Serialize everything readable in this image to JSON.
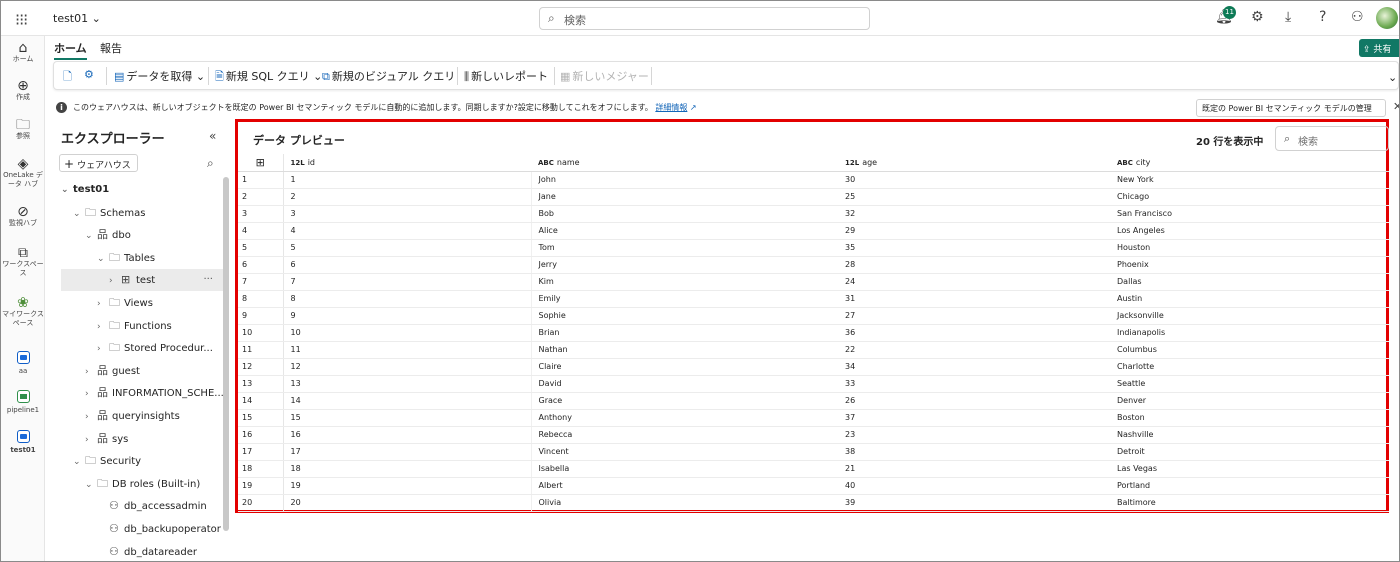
{
  "topbar": {
    "workspace": "test01",
    "search_placeholder": "検索",
    "notification_count": "11"
  },
  "rail": {
    "items": [
      {
        "label": "ホーム",
        "icon": "home-icon"
      },
      {
        "label": "作成",
        "icon": "create-icon"
      },
      {
        "label": "参照",
        "icon": "browse-icon"
      },
      {
        "label": "OneLake データ ハブ",
        "icon": "onelake-icon"
      },
      {
        "label": "監視ハブ",
        "icon": "monitor-icon"
      },
      {
        "label": "ワークスペース",
        "icon": "workspaces-icon"
      },
      {
        "label": "マイワークスペース",
        "icon": "my-workspace-icon"
      },
      {
        "label": "aa",
        "icon": "warehouse-icon"
      },
      {
        "label": "pipeline1",
        "icon": "pipeline-icon"
      },
      {
        "label": "test01",
        "icon": "warehouse-icon"
      }
    ]
  },
  "tabs": {
    "home": "ホーム",
    "report": "報告",
    "share": "共有"
  },
  "ribbon": {
    "get_data": "データを取得",
    "new_sql_query": "新規 SQL クエリ",
    "new_visual_query": "新規のビジュアル クエリ",
    "new_report": "新しいレポート",
    "new_measure": "新しいメジャー"
  },
  "info": {
    "text": "このウェアハウスは、新しいオブジェクトを既定の Power BI セマンティック モデルに自動的に追加します。同期しますか?設定に移動してこれをオフにします。",
    "link": "詳細情報",
    "button": "既定の Power BI セマンティック モデルの管理"
  },
  "explorer": {
    "title": "エクスプローラー",
    "add_warehouse": "ウェアハウス",
    "tree": [
      {
        "label": "test01",
        "depth": 0,
        "chev": "⌄",
        "icon": ""
      },
      {
        "label": "Schemas",
        "depth": 1,
        "chev": "⌄",
        "icon": "folder"
      },
      {
        "label": "dbo",
        "depth": 2,
        "chev": "⌄",
        "icon": "schema"
      },
      {
        "label": "Tables",
        "depth": 3,
        "chev": "⌄",
        "icon": "folder"
      },
      {
        "label": "test",
        "depth": 4,
        "chev": "›",
        "icon": "table",
        "selected": true
      },
      {
        "label": "Views",
        "depth": 3,
        "chev": "›",
        "icon": "folder"
      },
      {
        "label": "Functions",
        "depth": 3,
        "chev": "›",
        "icon": "folder"
      },
      {
        "label": "Stored Procedur...",
        "depth": 3,
        "chev": "›",
        "icon": "folder"
      },
      {
        "label": "guest",
        "depth": 2,
        "chev": "›",
        "icon": "schema"
      },
      {
        "label": "INFORMATION_SCHE...",
        "depth": 2,
        "chev": "›",
        "icon": "schema"
      },
      {
        "label": "queryinsights",
        "depth": 2,
        "chev": "›",
        "icon": "schema"
      },
      {
        "label": "sys",
        "depth": 2,
        "chev": "›",
        "icon": "schema"
      },
      {
        "label": "Security",
        "depth": 1,
        "chev": "⌄",
        "icon": "folder"
      },
      {
        "label": "DB roles (Built-in)",
        "depth": 2,
        "chev": "⌄",
        "icon": "folder"
      },
      {
        "label": "db_accessadmin",
        "depth": 3,
        "chev": "",
        "icon": "role"
      },
      {
        "label": "db_backupoperator",
        "depth": 3,
        "chev": "",
        "icon": "role"
      },
      {
        "label": "db_datareader",
        "depth": 3,
        "chev": "",
        "icon": "role"
      }
    ]
  },
  "preview": {
    "title": "データ プレビュー",
    "row_count": "20 行を表示中",
    "search_placeholder": "検索",
    "columns": [
      {
        "type": "12L",
        "name": "id"
      },
      {
        "type": "ABC",
        "name": "name"
      },
      {
        "type": "12L",
        "name": "age"
      },
      {
        "type": "ABC",
        "name": "city"
      }
    ],
    "rows": [
      [
        "1",
        "1",
        "John",
        "30",
        "New York"
      ],
      [
        "2",
        "2",
        "Jane",
        "25",
        "Chicago"
      ],
      [
        "3",
        "3",
        "Bob",
        "32",
        "San Francisco"
      ],
      [
        "4",
        "4",
        "Alice",
        "29",
        "Los Angeles"
      ],
      [
        "5",
        "5",
        "Tom",
        "35",
        "Houston"
      ],
      [
        "6",
        "6",
        "Jerry",
        "28",
        "Phoenix"
      ],
      [
        "7",
        "7",
        "Kim",
        "24",
        "Dallas"
      ],
      [
        "8",
        "8",
        "Emily",
        "31",
        "Austin"
      ],
      [
        "9",
        "9",
        "Sophie",
        "27",
        "Jacksonville"
      ],
      [
        "10",
        "10",
        "Brian",
        "36",
        "Indianapolis"
      ],
      [
        "11",
        "11",
        "Nathan",
        "22",
        "Columbus"
      ],
      [
        "12",
        "12",
        "Claire",
        "34",
        "Charlotte"
      ],
      [
        "13",
        "13",
        "David",
        "33",
        "Seattle"
      ],
      [
        "14",
        "14",
        "Grace",
        "26",
        "Denver"
      ],
      [
        "15",
        "15",
        "Anthony",
        "37",
        "Boston"
      ],
      [
        "16",
        "16",
        "Rebecca",
        "23",
        "Nashville"
      ],
      [
        "17",
        "17",
        "Vincent",
        "38",
        "Detroit"
      ],
      [
        "18",
        "18",
        "Isabella",
        "21",
        "Las Vegas"
      ],
      [
        "19",
        "19",
        "Albert",
        "40",
        "Portland"
      ],
      [
        "20",
        "20",
        "Olivia",
        "39",
        "Baltimore"
      ]
    ]
  },
  "colors": {
    "accent": "#117865",
    "highlight_border": "#e30000",
    "link": "#1466b8"
  }
}
